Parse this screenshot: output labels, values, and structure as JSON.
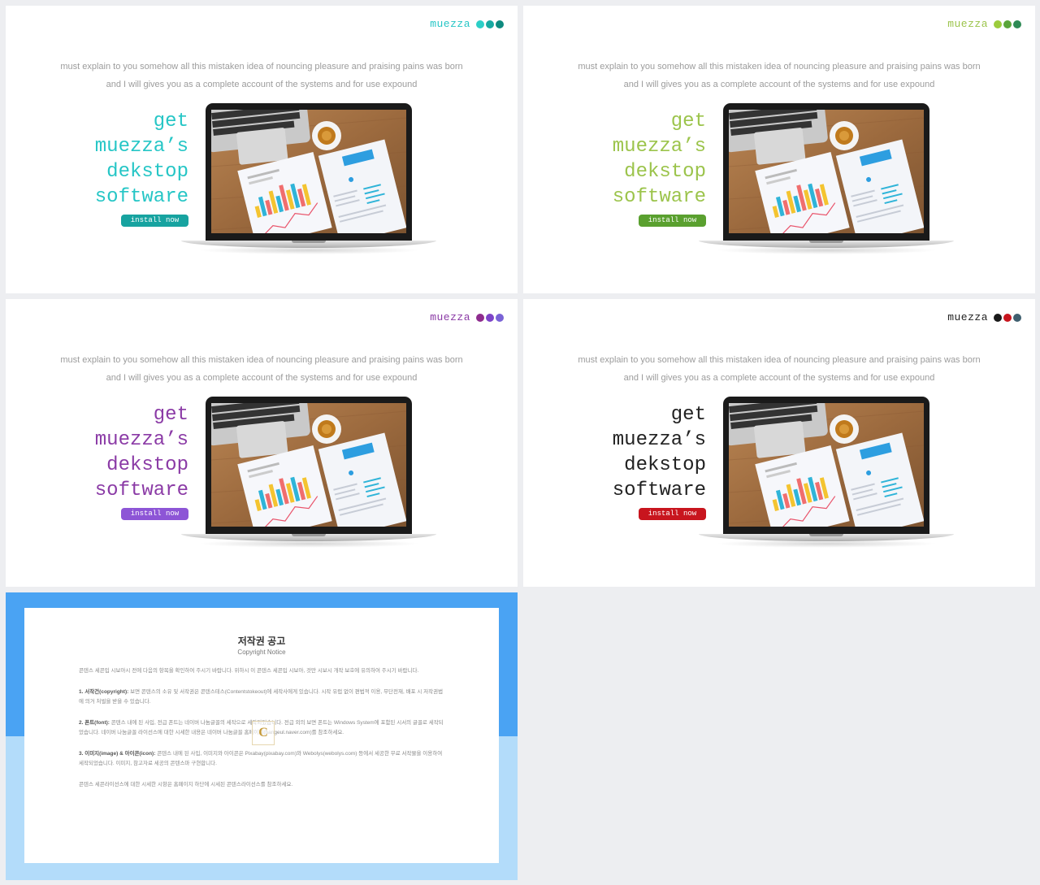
{
  "slides": [
    {
      "brand": "muezza",
      "intro": [
        "must explain to you somehow all this mistaken idea of nouncing pleasure and praising pains was born",
        "and I will gives you as a complete account of the systems and for use expound"
      ],
      "headline": [
        "get",
        "muezza’s",
        "dekstop",
        "software"
      ],
      "button": "install now",
      "colors": {
        "text": "#26c6c6",
        "button": "#17a3a0",
        "dots": [
          "#2ccfc7",
          "#17a9a1",
          "#0e8a7f"
        ]
      }
    },
    {
      "brand": "muezza",
      "intro": [
        "must explain to you somehow all this mistaken idea of nouncing pleasure and praising pains was born",
        "and I will gives you as a complete account of the systems and for use expound"
      ],
      "headline": [
        "get",
        "muezza’s",
        "dekstop",
        "software"
      ],
      "button": "install now",
      "colors": {
        "text": "#9cc44c",
        "button": "#5aa02f",
        "dots": [
          "#9ccc3c",
          "#5aa53a",
          "#2e8a55"
        ]
      }
    },
    {
      "brand": "muezza",
      "intro": [
        "must explain to you somehow all this mistaken idea of nouncing pleasure and praising pains was born",
        "and I will gives you as a complete account of the systems and for use expound"
      ],
      "headline": [
        "get",
        "muezza’s",
        "dekstop",
        "software"
      ],
      "button": "install now",
      "colors": {
        "text": "#8b3ba6",
        "button": "#8d55d6",
        "dots": [
          "#8e2c8e",
          "#7d44c8",
          "#7a63d6"
        ]
      }
    },
    {
      "brand": "muezza",
      "intro": [
        "must explain to you somehow all this mistaken idea of nouncing pleasure and praising pains was born",
        "and I will gives you as a complete account of the systems and for use expound"
      ],
      "headline": [
        "get",
        "muezza’s",
        "dekstop",
        "software"
      ],
      "button": "install now",
      "colors": {
        "text": "#222222",
        "button": "#c8151e",
        "dots": [
          "#1a1a1a",
          "#c8151e",
          "#3f5f6f"
        ]
      }
    }
  ],
  "copyright": {
    "title": "저작권 공고",
    "subtitle": "Copyright Notice",
    "logo_letter": "C",
    "paragraphs": [
      {
        "head": "",
        "text": "콘텐스 세콘입 시보아시 전에 다음의 항목을 확인하여 주시기 바랍니다. 위하시 이 콘텐스 세콘입 시보아, 것만 시보시 개작 보호에 유의하여 주시기 바랍니다."
      },
      {
        "head": "1. 서작건(copyright):",
        "text": "보면 콘텐스의 소유 및 서작권은 콘텐스테스(Contentstokeout)에 세작사에게 있습니다. 시작 유럽 없이 편법적 이용, 무단전재, 배포 시 저작권법에 의거 처벌을 받을 수 있습니다."
      },
      {
        "head": "2. 폰트(font):",
        "text": "콘텐스 내에 된 사입, 전급 폰트는 네이버 나눔글꼴의 세작으로 세작되었습니다. 전급 외의 보면 폰트는 Windows System에 포함된 시서의 글꼴로 세작되었습니다. 네이버 나눔글꼴 라이선스에 대한 시세한 내용은 네이버 나눔글꼴 홈페이지(hangeul.naver.com)를 참조하세요."
      },
      {
        "head": "3. 이미지(image) & 아이콘(icon):",
        "text": "콘텐스 내에 된 사입, 이미지와 아이콘은 Pixabay(pixabay.com)와 Webolys(webolys.com) 등에서 세공한 무료 서작물을 이용하여 세작되었습니다. 이미지, 참고자료 세공의 콘텐스마 구현합니다."
      },
      {
        "head": "",
        "text": "콘텐스 세콘라이선스에 대한 시세한 시항은 홈페이지 하단에 시세된 콘텐스라이선스를 참조하세요."
      }
    ]
  }
}
